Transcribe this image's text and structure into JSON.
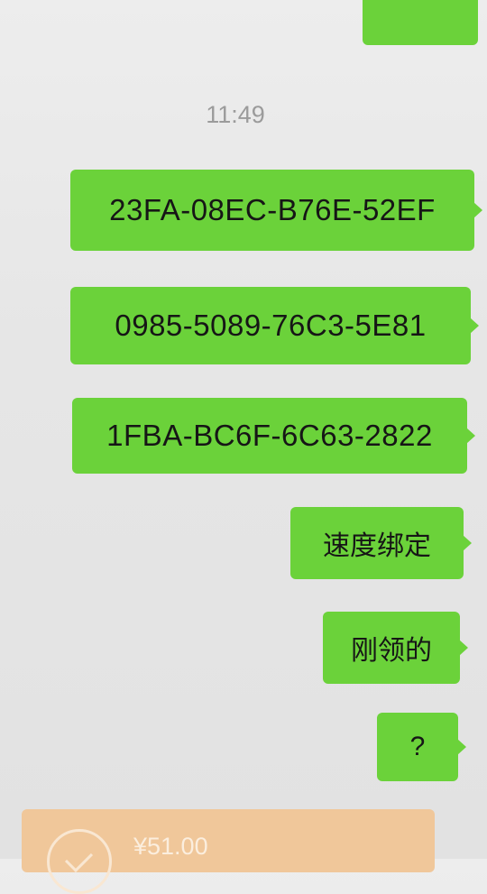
{
  "conversation": {
    "timestamp": "11:49",
    "messages": [
      {
        "text": "23FA-08EC-B76E-52EF"
      },
      {
        "text": "0985-5089-76C3-5E81"
      },
      {
        "text": "1FBA-BC6F-6C63-2822"
      },
      {
        "text": "速度绑定"
      },
      {
        "text": "刚领的"
      },
      {
        "text": "?"
      }
    ],
    "transfer": {
      "amount": "¥51.00",
      "icon": "check-circle-icon"
    }
  },
  "colors": {
    "bubble_green": "#6bd23a",
    "background": "#e6e6e6",
    "transfer_orange": "#f0c79a"
  }
}
